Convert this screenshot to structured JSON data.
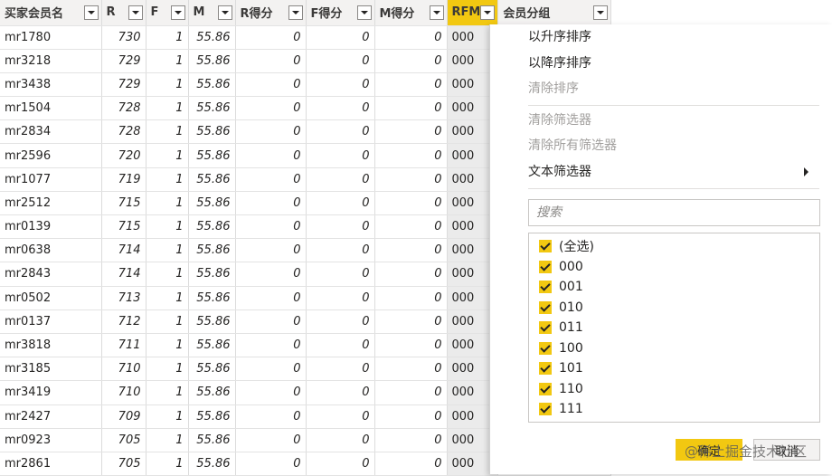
{
  "columns": [
    {
      "key": "name",
      "label": "买家会员名",
      "width": 112
    },
    {
      "key": "r",
      "label": "R",
      "width": 49
    },
    {
      "key": "f",
      "label": "F",
      "width": 47
    },
    {
      "key": "m",
      "label": "M",
      "width": 52
    },
    {
      "key": "rs",
      "label": "R得分",
      "width": 78
    },
    {
      "key": "fs",
      "label": "F得分",
      "width": 76
    },
    {
      "key": "ms",
      "label": "M得分",
      "width": 80
    },
    {
      "key": "rfm",
      "label": "RFM",
      "width": 47
    },
    {
      "key": "grp",
      "label": "会员分组",
      "width": 125
    }
  ],
  "rows": [
    [
      "mr1780",
      "730",
      "1",
      "55.86",
      "0",
      "0",
      "0",
      "000",
      ""
    ],
    [
      "mr3218",
      "729",
      "1",
      "55.86",
      "0",
      "0",
      "0",
      "000",
      ""
    ],
    [
      "mr3438",
      "729",
      "1",
      "55.86",
      "0",
      "0",
      "0",
      "000",
      ""
    ],
    [
      "mr1504",
      "728",
      "1",
      "55.86",
      "0",
      "0",
      "0",
      "000",
      ""
    ],
    [
      "mr2834",
      "728",
      "1",
      "55.86",
      "0",
      "0",
      "0",
      "000",
      ""
    ],
    [
      "mr2596",
      "720",
      "1",
      "55.86",
      "0",
      "0",
      "0",
      "000",
      ""
    ],
    [
      "mr1077",
      "719",
      "1",
      "55.86",
      "0",
      "0",
      "0",
      "000",
      ""
    ],
    [
      "mr2512",
      "715",
      "1",
      "55.86",
      "0",
      "0",
      "0",
      "000",
      ""
    ],
    [
      "mr0139",
      "715",
      "1",
      "55.86",
      "0",
      "0",
      "0",
      "000",
      ""
    ],
    [
      "mr0638",
      "714",
      "1",
      "55.86",
      "0",
      "0",
      "0",
      "000",
      ""
    ],
    [
      "mr2843",
      "714",
      "1",
      "55.86",
      "0",
      "0",
      "0",
      "000",
      ""
    ],
    [
      "mr0502",
      "713",
      "1",
      "55.86",
      "0",
      "0",
      "0",
      "000",
      ""
    ],
    [
      "mr0137",
      "712",
      "1",
      "55.86",
      "0",
      "0",
      "0",
      "000",
      ""
    ],
    [
      "mr3818",
      "711",
      "1",
      "55.86",
      "0",
      "0",
      "0",
      "000",
      ""
    ],
    [
      "mr3185",
      "710",
      "1",
      "55.86",
      "0",
      "0",
      "0",
      "000",
      ""
    ],
    [
      "mr3419",
      "710",
      "1",
      "55.86",
      "0",
      "0",
      "0",
      "000",
      ""
    ],
    [
      "mr2427",
      "709",
      "1",
      "55.86",
      "0",
      "0",
      "0",
      "000",
      ""
    ],
    [
      "mr0923",
      "705",
      "1",
      "55.86",
      "0",
      "0",
      "0",
      "000",
      ""
    ],
    [
      "mr2861",
      "705",
      "1",
      "55.86",
      "0",
      "0",
      "0",
      "000",
      ""
    ]
  ],
  "filter_panel": {
    "sort_asc": "以升序排序",
    "sort_desc": "以降序排序",
    "clear_sort": "清除排序",
    "clear_filter": "清除筛选器",
    "clear_all_filters": "清除所有筛选器",
    "text_filter": "文本筛选器",
    "search_placeholder": "搜索",
    "options": [
      "(全选)",
      "000",
      "001",
      "010",
      "011",
      "100",
      "101",
      "110",
      "111"
    ],
    "ok_label": "确定",
    "cancel_label": "取消"
  },
  "watermark": "@稀土掘金技术社区",
  "colors": {
    "accent": "#f2c811",
    "header_bg": "#f3f2f1",
    "disabled": "#a19f9d"
  }
}
